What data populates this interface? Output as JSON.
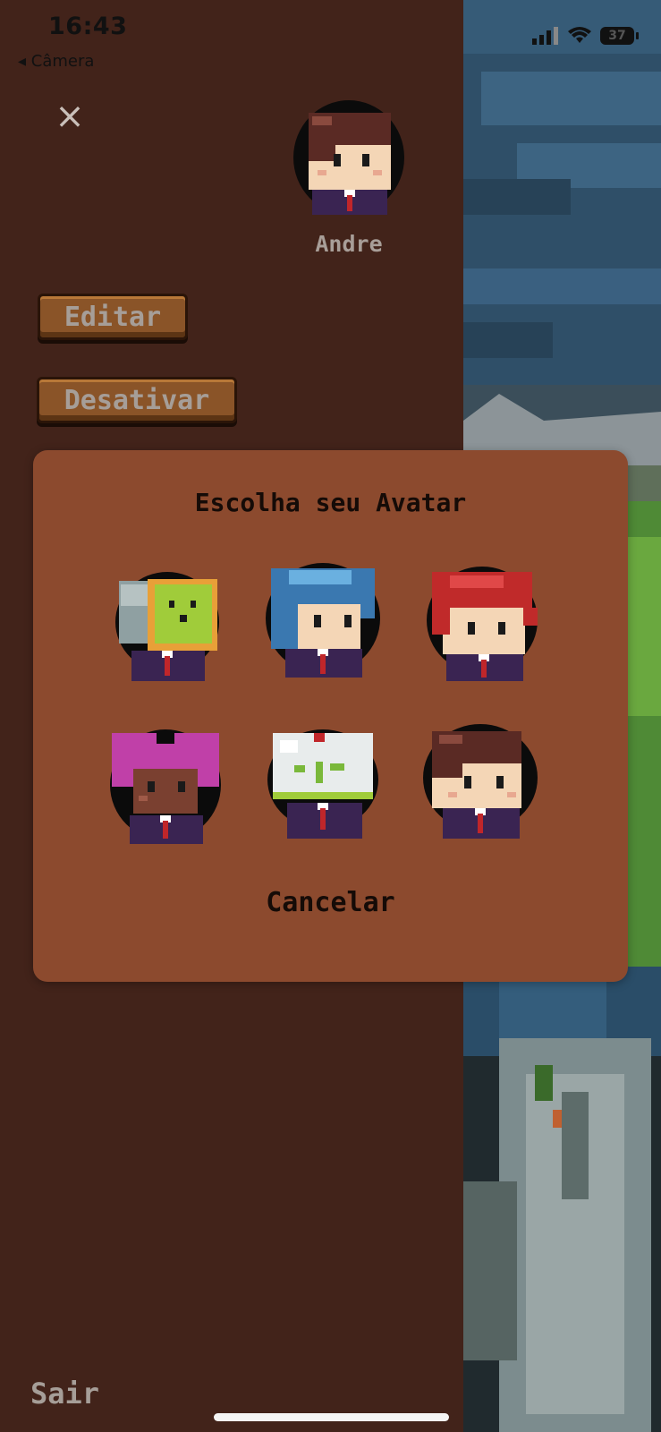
{
  "status_bar": {
    "time": "16:43",
    "back_label": "◂ Câmera",
    "battery": "37"
  },
  "profile": {
    "name": "Andre"
  },
  "buttons": {
    "close_icon": "×",
    "editor": "Editar",
    "desativar": "Desativar",
    "sair": "Sair"
  },
  "modal": {
    "title": "Escolha seu Avatar",
    "avatars": [
      "monitor-bot",
      "blue-hair",
      "red-hair",
      "pink-hair",
      "plant-dome",
      "brown-hair"
    ],
    "cancel": "Cancelar"
  },
  "colors": {
    "panel_bg": "#42231a",
    "modal_bg": "#8c4a2e",
    "button_bg": "#8a5428",
    "suit": "#3a2452",
    "tie": "#c0262a"
  }
}
